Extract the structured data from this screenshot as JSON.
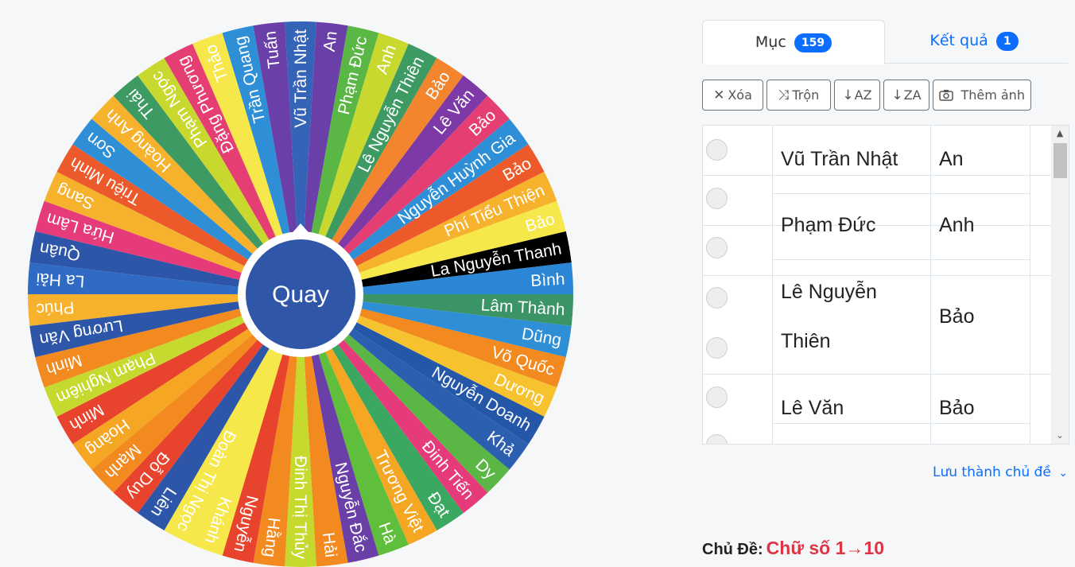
{
  "wheel": {
    "spin_label": "Quay",
    "segments": [
      {
        "label": "Vũ Trần Nhật",
        "color": "#3563b8"
      },
      {
        "label": "An",
        "color": "#6a3fa8"
      },
      {
        "label": "Phạm Đức",
        "color": "#5ab745"
      },
      {
        "label": "Anh",
        "color": "#c9d82f"
      },
      {
        "label": "Lê Nguyễn Thiên",
        "color": "#3e9a63"
      },
      {
        "label": "Bảo",
        "color": "#f3852e"
      },
      {
        "label": "Lê Văn",
        "color": "#7d3aa6"
      },
      {
        "label": "Bảo",
        "color": "#e43e73"
      },
      {
        "label": "Nguyễn Huỳnh Gia",
        "color": "#2f8fd6"
      },
      {
        "label": "Bảo",
        "color": "#ec5a2b"
      },
      {
        "label": "Phí Tiểu Thiện",
        "color": "#f6b22c"
      },
      {
        "label": "Bảo",
        "color": "#f6e74a"
      },
      {
        "label": "La Nguyễn Thanh",
        "color": "#000000"
      },
      {
        "label": "Bình",
        "color": "#2b86d5"
      },
      {
        "label": "Lâm Thành",
        "color": "#3a9466"
      },
      {
        "label": "Dũng",
        "color": "#2f8fd6"
      },
      {
        "label": "Võ Quốc",
        "color": "#f28a1f"
      },
      {
        "label": "Dương",
        "color": "#f6c22e"
      },
      {
        "label": "Nguyễn Doanh",
        "color": "#2557a8"
      },
      {
        "label": "Khả",
        "color": "#2d5fb0"
      },
      {
        "label": "Dy",
        "color": "#5ab745"
      },
      {
        "label": "Đinh Tiến",
        "color": "#e63b7a"
      },
      {
        "label": "Đạt",
        "color": "#3aa860"
      },
      {
        "label": "Trương Việt",
        "color": "#f5a623"
      },
      {
        "label": "Hà",
        "color": "#5fbf3d"
      },
      {
        "label": "Nguyễn Đắc",
        "color": "#6a3fa8"
      },
      {
        "label": "Hải",
        "color": "#f28a1f"
      },
      {
        "label": "Đinh Thị Thủy",
        "color": "#c5d92f"
      },
      {
        "label": "Hằng",
        "color": "#f28a1f"
      },
      {
        "label": "Nguyễn",
        "color": "#e8442d"
      },
      {
        "label": "Khánh",
        "color": "#f6e74a"
      },
      {
        "label": "Đoàn Thị Ngọc",
        "color": "#f6e74a"
      },
      {
        "label": "Liên",
        "color": "#2d56a8"
      },
      {
        "label": "Đỗ Duy",
        "color": "#e8442d"
      },
      {
        "label": "Mạnh",
        "color": "#f28a1f"
      },
      {
        "label": "Hoàng",
        "color": "#f5a623"
      },
      {
        "label": "Minh",
        "color": "#e8442d"
      },
      {
        "label": "Phạm Nghiêm",
        "color": "#c5d92f"
      },
      {
        "label": "Minh",
        "color": "#f28a1f"
      },
      {
        "label": "Lương Văn",
        "color": "#2d56a8"
      },
      {
        "label": "Phúc",
        "color": "#f6b22c"
      },
      {
        "label": "La Hải",
        "color": "#2f6bc4"
      },
      {
        "label": "Quân",
        "color": "#2d56a8"
      },
      {
        "label": "Hứa Lâm",
        "color": "#e63b7a"
      },
      {
        "label": "Sang",
        "color": "#f6b22c"
      },
      {
        "label": "Triệu Minh",
        "color": "#ec5a2b"
      },
      {
        "label": "Sơn",
        "color": "#2f8fd6"
      },
      {
        "label": "Hoàng Anh",
        "color": "#f6b22c"
      },
      {
        "label": "Thái",
        "color": "#3e9a63"
      },
      {
        "label": "Phạm Ngọc",
        "color": "#c9d82f"
      },
      {
        "label": "Đặng Phương",
        "color": "#e43e73"
      },
      {
        "label": "Thảo",
        "color": "#f6e74a"
      },
      {
        "label": "Trần Quang",
        "color": "#2f8fd6"
      },
      {
        "label": "Tuấn",
        "color": "#6a3fa8"
      }
    ]
  },
  "tabs": {
    "items_label": "Mục",
    "items_count": "159",
    "results_label": "Kết quả",
    "results_count": "1"
  },
  "toolbar": {
    "clear": "Xóa",
    "shuffle": "Trộn",
    "sort_az": "AZ",
    "sort_za": "ZA",
    "add_image": "Thêm ảnh"
  },
  "entries": [
    {
      "first": "Vũ Trần Nhật",
      "last": "An"
    },
    {
      "first": "Phạm Đức",
      "last": "Anh"
    },
    {
      "first_line1": "Lê Nguyễn",
      "first_line2": "Thiên",
      "last": "Bảo"
    },
    {
      "first": "Lê Văn",
      "last": "Bảo"
    }
  ],
  "save_link": "Lưu thành chủ đề",
  "topic": {
    "label": "Chủ Đề:",
    "value": "Chữ số 1→10"
  }
}
